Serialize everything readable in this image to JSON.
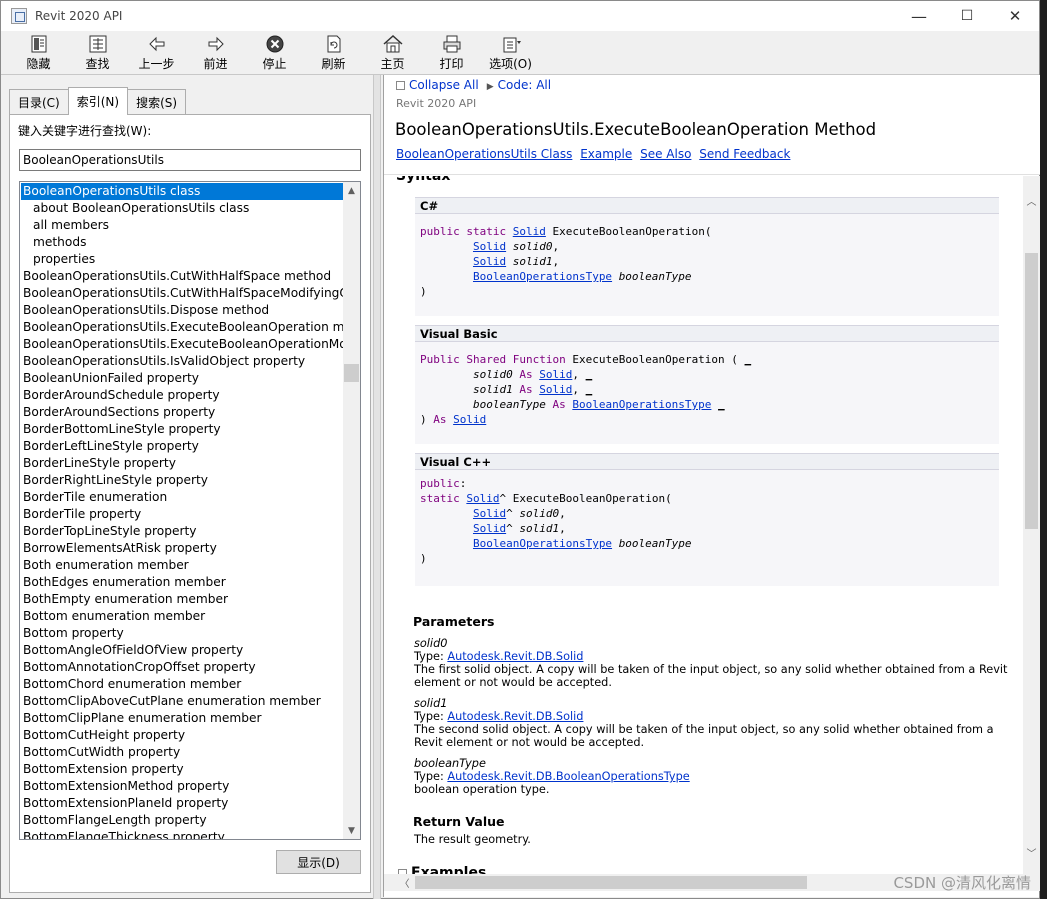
{
  "window": {
    "title": "Revit 2020 API"
  },
  "window_controls": {
    "minimize": "—",
    "maximize": "☐",
    "close": "✕"
  },
  "toolbar": {
    "buttons": [
      {
        "label": "隐藏",
        "icon": "hide-icon"
      },
      {
        "label": "查找",
        "icon": "find-icon"
      },
      {
        "label": "上一步",
        "icon": "back-arrow-icon"
      },
      {
        "label": "前进",
        "icon": "forward-arrow-icon"
      },
      {
        "label": "停止",
        "icon": "stop-icon"
      },
      {
        "label": "刷新",
        "icon": "refresh-icon"
      },
      {
        "label": "主页",
        "icon": "home-icon"
      },
      {
        "label": "打印",
        "icon": "print-icon"
      },
      {
        "label": "选项(O)",
        "icon": "options-icon"
      }
    ]
  },
  "left": {
    "tabs": [
      {
        "label": "目录(C)",
        "active": false
      },
      {
        "label": "索引(N)",
        "active": true
      },
      {
        "label": "搜索(S)",
        "active": false
      }
    ],
    "keyword_label": "键入关键字进行查找(W):",
    "keyword_value": "BooleanOperationsUtils",
    "index_items": [
      {
        "text": "BooleanOperationsUtils class",
        "indent": false,
        "selected": true
      },
      {
        "text": "about BooleanOperationsUtils class",
        "indent": true,
        "selected": false
      },
      {
        "text": "all members",
        "indent": true,
        "selected": false
      },
      {
        "text": "methods",
        "indent": true,
        "selected": false
      },
      {
        "text": "properties",
        "indent": true,
        "selected": false
      },
      {
        "text": "BooleanOperationsUtils.CutWithHalfSpace method",
        "indent": false,
        "selected": false
      },
      {
        "text": "BooleanOperationsUtils.CutWithHalfSpaceModifyingOri",
        "indent": false,
        "selected": false
      },
      {
        "text": "BooleanOperationsUtils.Dispose method",
        "indent": false,
        "selected": false
      },
      {
        "text": "BooleanOperationsUtils.ExecuteBooleanOperation meth",
        "indent": false,
        "selected": false
      },
      {
        "text": "BooleanOperationsUtils.ExecuteBooleanOperationMod",
        "indent": false,
        "selected": false
      },
      {
        "text": "BooleanOperationsUtils.IsValidObject property",
        "indent": false,
        "selected": false
      },
      {
        "text": "BooleanUnionFailed property",
        "indent": false,
        "selected": false
      },
      {
        "text": "BorderAroundSchedule property",
        "indent": false,
        "selected": false
      },
      {
        "text": "BorderAroundSections property",
        "indent": false,
        "selected": false
      },
      {
        "text": "BorderBottomLineStyle property",
        "indent": false,
        "selected": false
      },
      {
        "text": "BorderLeftLineStyle property",
        "indent": false,
        "selected": false
      },
      {
        "text": "BorderLineStyle property",
        "indent": false,
        "selected": false
      },
      {
        "text": "BorderRightLineStyle property",
        "indent": false,
        "selected": false
      },
      {
        "text": "BorderTile enumeration",
        "indent": false,
        "selected": false
      },
      {
        "text": "BorderTile property",
        "indent": false,
        "selected": false
      },
      {
        "text": "BorderTopLineStyle property",
        "indent": false,
        "selected": false
      },
      {
        "text": "BorrowElementsAtRisk property",
        "indent": false,
        "selected": false
      },
      {
        "text": "Both enumeration member",
        "indent": false,
        "selected": false
      },
      {
        "text": "BothEdges enumeration member",
        "indent": false,
        "selected": false
      },
      {
        "text": "BothEmpty enumeration member",
        "indent": false,
        "selected": false
      },
      {
        "text": "Bottom enumeration member",
        "indent": false,
        "selected": false
      },
      {
        "text": "Bottom property",
        "indent": false,
        "selected": false
      },
      {
        "text": "BottomAngleOfFieldOfView property",
        "indent": false,
        "selected": false
      },
      {
        "text": "BottomAnnotationCropOffset property",
        "indent": false,
        "selected": false
      },
      {
        "text": "BottomChord enumeration member",
        "indent": false,
        "selected": false
      },
      {
        "text": "BottomClipAboveCutPlane enumeration member",
        "indent": false,
        "selected": false
      },
      {
        "text": "BottomClipPlane enumeration member",
        "indent": false,
        "selected": false
      },
      {
        "text": "BottomCutHeight property",
        "indent": false,
        "selected": false
      },
      {
        "text": "BottomCutWidth property",
        "indent": false,
        "selected": false
      },
      {
        "text": "BottomExtension property",
        "indent": false,
        "selected": false
      },
      {
        "text": "BottomExtensionMethod property",
        "indent": false,
        "selected": false
      },
      {
        "text": "BottomExtensionPlaneId property",
        "indent": false,
        "selected": false
      },
      {
        "text": "BottomFlangeLength property",
        "indent": false,
        "selected": false
      },
      {
        "text": "BottomFlangeThickness property",
        "indent": false,
        "selected": false
      }
    ],
    "show_button": "显示(D)"
  },
  "right": {
    "collapse_all": "Collapse All",
    "code_all": "Code: All",
    "revit_api": "Revit 2020 API",
    "page_title": "BooleanOperationsUtils.ExecuteBooleanOperation Method",
    "links": [
      "BooleanOperationsUtils Class",
      "Example",
      "See Also",
      "Send Feedback"
    ],
    "syntax_heading": "Syntax",
    "code_blocks": {
      "csharp_title": "C#",
      "vb_title": "Visual Basic",
      "cpp_title": "Visual C++"
    },
    "parameters_heading": "Parameters",
    "parameters": [
      {
        "name": "solid0",
        "type_prefix": "Type:",
        "type": "Autodesk.Revit.DB.Solid",
        "desc": "The first solid object. A copy will be taken of the input object, so any solid whether obtained from a Revit element or not would be accepted."
      },
      {
        "name": "solid1",
        "type_prefix": "Type:",
        "type": "Autodesk.Revit.DB.Solid",
        "desc": "The second solid object. A copy will be taken of the input object, so any solid whether obtained from a Revit element or not would be accepted."
      },
      {
        "name": "booleanType",
        "type_prefix": "Type:",
        "type": "Autodesk.Revit.DB.BooleanOperationsType",
        "desc": "boolean operation type."
      }
    ],
    "return_heading": "Return Value",
    "return_desc": "The result geometry.",
    "examples_heading": "Examples"
  },
  "watermark": "CSDN @清风化离情"
}
